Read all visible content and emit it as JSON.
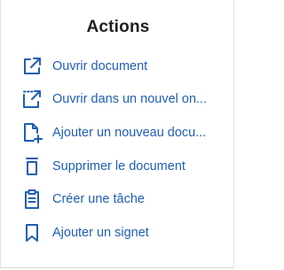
{
  "panel": {
    "title": "Actions",
    "accent_color": "#1f5fb5",
    "items": [
      {
        "label": "Ouvrir document",
        "icon": "external-link-icon"
      },
      {
        "label": "Ouvrir dans un nouvel on...",
        "icon": "open-new-window-icon"
      },
      {
        "label": "Ajouter un nouveau docu...",
        "icon": "add-document-icon"
      },
      {
        "label": "Supprimer le document",
        "icon": "trash-icon"
      },
      {
        "label": "Créer une tâche",
        "icon": "clipboard-task-icon"
      },
      {
        "label": "Ajouter un signet",
        "icon": "bookmark-icon"
      }
    ]
  }
}
